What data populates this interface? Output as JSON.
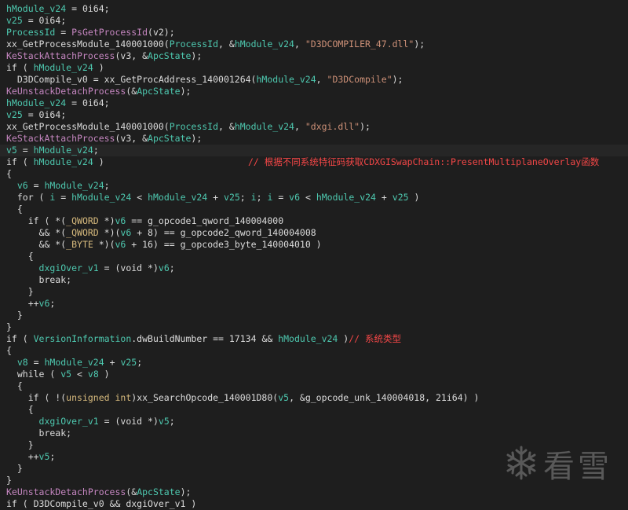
{
  "editor": {
    "lines": [
      {
        "segs": [
          [
            "g",
            "hModule_v24"
          ],
          [
            "k",
            " = 0i64;"
          ]
        ]
      },
      {
        "segs": [
          [
            "g",
            "v25"
          ],
          [
            "k",
            " = 0i64;"
          ]
        ]
      },
      {
        "segs": [
          [
            "g",
            "ProcessId"
          ],
          [
            "k",
            " = "
          ],
          [
            "m",
            "PsGetProcessId"
          ],
          [
            "k",
            "(v2);"
          ]
        ]
      },
      {
        "segs": [
          [
            "k",
            "xx_GetProcessModule_140001000("
          ],
          [
            "g",
            "ProcessId"
          ],
          [
            "k",
            ", &"
          ],
          [
            "g",
            "hModule_v24"
          ],
          [
            "k",
            ", "
          ],
          [
            "s",
            "\"D3DCOMPILER_47.dll\""
          ],
          [
            "k",
            ");"
          ]
        ]
      },
      {
        "segs": [
          [
            "m",
            "KeStackAttachProcess"
          ],
          [
            "k",
            "(v3, &"
          ],
          [
            "g",
            "ApcState"
          ],
          [
            "k",
            ");"
          ]
        ]
      },
      {
        "segs": [
          [
            "k",
            "if ( "
          ],
          [
            "g",
            "hModule_v24"
          ],
          [
            "k",
            " )"
          ]
        ]
      },
      {
        "segs": [
          [
            "k",
            "  D3DCompile_v0 = xx_GetProcAddress_140001264("
          ],
          [
            "g",
            "hModule_v24"
          ],
          [
            "k",
            ", "
          ],
          [
            "s",
            "\"D3DCompile\""
          ],
          [
            "k",
            ");"
          ]
        ]
      },
      {
        "segs": [
          [
            "m",
            "KeUnstackDetachProcess"
          ],
          [
            "k",
            "(&"
          ],
          [
            "g",
            "ApcState"
          ],
          [
            "k",
            ");"
          ]
        ]
      },
      {
        "segs": [
          [
            "g",
            "hModule_v24"
          ],
          [
            "k",
            " = 0i64;"
          ]
        ]
      },
      {
        "segs": [
          [
            "g",
            "v25"
          ],
          [
            "k",
            " = 0i64;"
          ]
        ]
      },
      {
        "segs": [
          [
            "k",
            "xx_GetProcessModule_140001000("
          ],
          [
            "g",
            "ProcessId"
          ],
          [
            "k",
            ", &"
          ],
          [
            "g",
            "hModule_v24"
          ],
          [
            "k",
            ", "
          ],
          [
            "s",
            "\"dxgi.dll\""
          ],
          [
            "k",
            ");"
          ]
        ]
      },
      {
        "segs": [
          [
            "m",
            "KeStackAttachProcess"
          ],
          [
            "k",
            "(v3, &"
          ],
          [
            "g",
            "ApcState"
          ],
          [
            "k",
            ");"
          ]
        ]
      },
      {
        "segs": [
          [
            "g",
            "v5"
          ],
          [
            "k",
            " = "
          ],
          [
            "g",
            "hModule_v24"
          ],
          [
            "k",
            ";"
          ]
        ],
        "highlight": true
      },
      {
        "segs": [
          [
            "k",
            "if ( "
          ],
          [
            "g",
            "hModule_v24"
          ],
          [
            "k",
            " )"
          ]
        ],
        "comment": "// 根据不同系统特征码获取CDXGISwapChain::PresentMultiplaneOverlay函数"
      },
      {
        "segs": [
          [
            "k",
            "{"
          ]
        ]
      },
      {
        "segs": [
          [
            "k",
            "  "
          ],
          [
            "g",
            "v6"
          ],
          [
            "k",
            " = "
          ],
          [
            "g",
            "hModule_v24"
          ],
          [
            "k",
            ";"
          ]
        ]
      },
      {
        "segs": [
          [
            "k",
            "  for ( "
          ],
          [
            "g",
            "i"
          ],
          [
            "k",
            " = "
          ],
          [
            "g",
            "hModule_v24"
          ],
          [
            "k",
            " < "
          ],
          [
            "g",
            "hModule_v24"
          ],
          [
            "k",
            " + "
          ],
          [
            "g",
            "v25"
          ],
          [
            "k",
            "; "
          ],
          [
            "g",
            "i"
          ],
          [
            "k",
            "; "
          ],
          [
            "g",
            "i"
          ],
          [
            "k",
            " = "
          ],
          [
            "g",
            "v6"
          ],
          [
            "k",
            " < "
          ],
          [
            "g",
            "hModule_v24"
          ],
          [
            "k",
            " + "
          ],
          [
            "g",
            "v25"
          ],
          [
            "k",
            " )"
          ]
        ]
      },
      {
        "segs": [
          [
            "k",
            "  {"
          ]
        ]
      },
      {
        "segs": [
          [
            "k",
            "    if ( *("
          ],
          [
            "t",
            "_QWORD"
          ],
          [
            "k",
            " *)"
          ],
          [
            "g",
            "v6"
          ],
          [
            "k",
            " == g_opcode1_qword_140004000"
          ]
        ]
      },
      {
        "segs": [
          [
            "k",
            "      && *("
          ],
          [
            "t",
            "_QWORD"
          ],
          [
            "k",
            " *)("
          ],
          [
            "g",
            "v6"
          ],
          [
            "k",
            " + 8) == g_opcode2_qword_140004008"
          ]
        ]
      },
      {
        "segs": [
          [
            "k",
            "      && *("
          ],
          [
            "t",
            "_BYTE"
          ],
          [
            "k",
            " *)("
          ],
          [
            "g",
            "v6"
          ],
          [
            "k",
            " + 16) == g_opcode3_byte_140004010 )"
          ]
        ]
      },
      {
        "segs": [
          [
            "k",
            "    {"
          ]
        ]
      },
      {
        "segs": [
          [
            "k",
            "      "
          ],
          [
            "g",
            "dxgiOver_v1"
          ],
          [
            "k",
            " = (void *)"
          ],
          [
            "g",
            "v6"
          ],
          [
            "k",
            ";"
          ]
        ]
      },
      {
        "segs": [
          [
            "k",
            "      break;"
          ]
        ]
      },
      {
        "segs": [
          [
            "k",
            "    }"
          ]
        ]
      },
      {
        "segs": [
          [
            "k",
            "    ++"
          ],
          [
            "g",
            "v6"
          ],
          [
            "k",
            ";"
          ]
        ]
      },
      {
        "segs": [
          [
            "k",
            "  }"
          ]
        ]
      },
      {
        "segs": [
          [
            "k",
            "}"
          ]
        ]
      },
      {
        "segs": [
          [
            "k",
            "if ( "
          ],
          [
            "g",
            "VersionInformation"
          ],
          [
            "k",
            ".dwBuildNumber == 17134 && "
          ],
          [
            "g",
            "hModule_v24"
          ],
          [
            "k",
            " )"
          ],
          [
            "ci",
            "// 系统类型"
          ]
        ]
      },
      {
        "segs": [
          [
            "k",
            "{"
          ]
        ]
      },
      {
        "segs": [
          [
            "k",
            "  "
          ],
          [
            "g",
            "v8"
          ],
          [
            "k",
            " = "
          ],
          [
            "g",
            "hModule_v24"
          ],
          [
            "k",
            " + "
          ],
          [
            "g",
            "v25"
          ],
          [
            "k",
            ";"
          ]
        ]
      },
      {
        "segs": [
          [
            "k",
            "  while ( "
          ],
          [
            "g",
            "v5"
          ],
          [
            "k",
            " < "
          ],
          [
            "g",
            "v8"
          ],
          [
            "k",
            " )"
          ]
        ]
      },
      {
        "segs": [
          [
            "k",
            "  {"
          ]
        ]
      },
      {
        "segs": [
          [
            "k",
            "    if ( !("
          ],
          [
            "t",
            "unsigned int"
          ],
          [
            "k",
            ")xx_SearchOpcode_140001D80("
          ],
          [
            "g",
            "v5"
          ],
          [
            "k",
            ", &g_opcode_unk_140004018, 21i64) )"
          ]
        ]
      },
      {
        "segs": [
          [
            "k",
            "    {"
          ]
        ]
      },
      {
        "segs": [
          [
            "k",
            "      "
          ],
          [
            "g",
            "dxgiOver_v1"
          ],
          [
            "k",
            " = (void *)"
          ],
          [
            "g",
            "v5"
          ],
          [
            "k",
            ";"
          ]
        ]
      },
      {
        "segs": [
          [
            "k",
            "      break;"
          ]
        ]
      },
      {
        "segs": [
          [
            "k",
            "    }"
          ]
        ]
      },
      {
        "segs": [
          [
            "k",
            "    ++"
          ],
          [
            "g",
            "v5"
          ],
          [
            "k",
            ";"
          ]
        ]
      },
      {
        "segs": [
          [
            "k",
            "  }"
          ]
        ]
      },
      {
        "segs": [
          [
            "k",
            "}"
          ]
        ]
      },
      {
        "segs": [
          [
            "m",
            "KeUnstackDetachProcess"
          ],
          [
            "k",
            "(&"
          ],
          [
            "g",
            "ApcState"
          ],
          [
            "k",
            ");"
          ]
        ]
      },
      {
        "segs": [
          [
            "k",
            "if ( D3DCompile_v0 && dxgiOver_v1 )"
          ]
        ]
      }
    ]
  },
  "watermark": {
    "icon": "snowflake-icon",
    "text": "看雪"
  }
}
